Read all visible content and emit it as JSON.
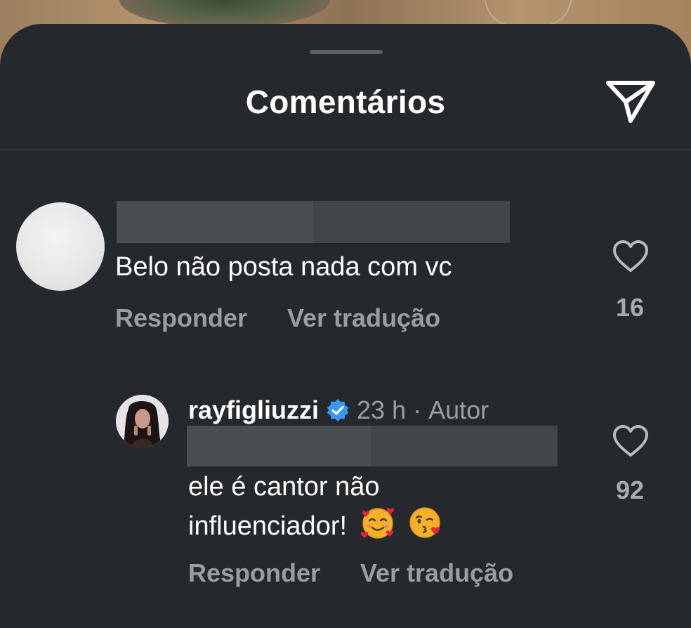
{
  "header": {
    "title": "Comentários",
    "share_icon": "paper-plane-icon"
  },
  "comments": [
    {
      "username_redacted": true,
      "text": "Belo não posta nada com vc",
      "reply_label": "Responder",
      "translate_label": "Ver tradução",
      "like_count": "16"
    },
    {
      "username": "rayfigliuzzi",
      "verified": true,
      "time": "23 h",
      "separator": "·",
      "author_tag": "Autor",
      "mention_redacted": true,
      "text_line1": "ele é cantor não",
      "text_line2": "influenciador!",
      "emojis": [
        "smiling-face-with-hearts",
        "face-blowing-a-kiss"
      ],
      "reply_label": "Responder",
      "translate_label": "Ver tradução",
      "like_count": "92"
    }
  ],
  "colors": {
    "sheet_bg": "#25292e",
    "text_primary": "#ffffff",
    "text_secondary": "#9a9ea4",
    "verified_blue": "#3897f0",
    "redaction": "#4a4d51"
  }
}
